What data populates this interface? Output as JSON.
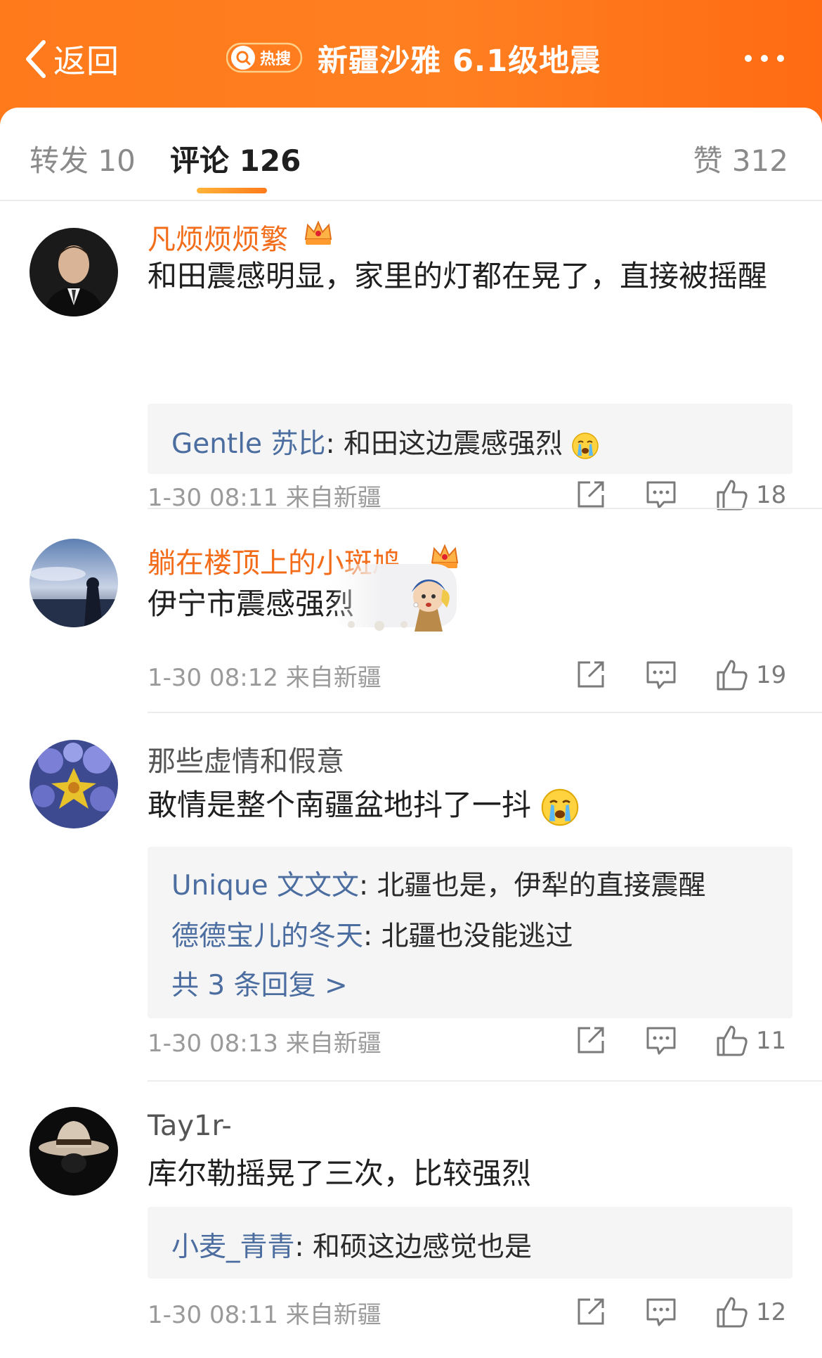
{
  "header": {
    "back_label": "返回",
    "hot_badge": "热搜",
    "title": "新疆沙雅 6.1级地震"
  },
  "tabs": {
    "forward_label": "转发 10",
    "comments_label": "评论 126",
    "likes_label": "赞 312"
  },
  "comments": [
    {
      "username": "凡烦烦烦繁",
      "vip": true,
      "text": "和田震感明显，家里的灯都在晃了，直接被摇醒",
      "replies": [
        {
          "name": "Gentle 苏比",
          "text": ": 和田这边震感强烈"
        }
      ],
      "time": "1-30 08:11",
      "source": "来自新疆",
      "likes": "18"
    },
    {
      "username": "躺在楼顶上的小斑鸠",
      "vip": true,
      "text": "伊宁市震感强烈",
      "replies": [],
      "time": "1-30 08:12",
      "source": "来自新疆",
      "likes": "19"
    },
    {
      "username": "那些虚情和假意",
      "vip": false,
      "text": "敢情是整个南疆盆地抖了一抖",
      "replies": [
        {
          "name": "Unique 文文文",
          "text": ": 北疆也是，伊犁的直接震醒"
        },
        {
          "name": "德德宝儿的冬天",
          "text": ": 北疆也没能逃过"
        }
      ],
      "more_replies": "共 3 条回复 >",
      "time": "1-30 08:13",
      "source": "来自新疆",
      "likes": "11"
    },
    {
      "username": "Tay1r-",
      "vip": false,
      "text": "库尔勒摇晃了三次，比较强烈",
      "replies": [
        {
          "name": "小麦_青青",
          "text": ": 和硕这边感觉也是"
        }
      ],
      "time": "1-30 08:11",
      "source": "来自新疆",
      "likes": "12"
    }
  ],
  "icons": {
    "back": "chevron-left-icon",
    "more": "more-dots-icon",
    "share": "share-icon",
    "reply": "comment-icon",
    "like": "thumbs-up-icon",
    "crown": "vip-crown-icon",
    "crying": "crying-emoji-icon"
  },
  "colors": {
    "header_orange": "#ff7a1b",
    "vip_name": "#f26c1a",
    "reply_name": "#4b6d9f"
  }
}
